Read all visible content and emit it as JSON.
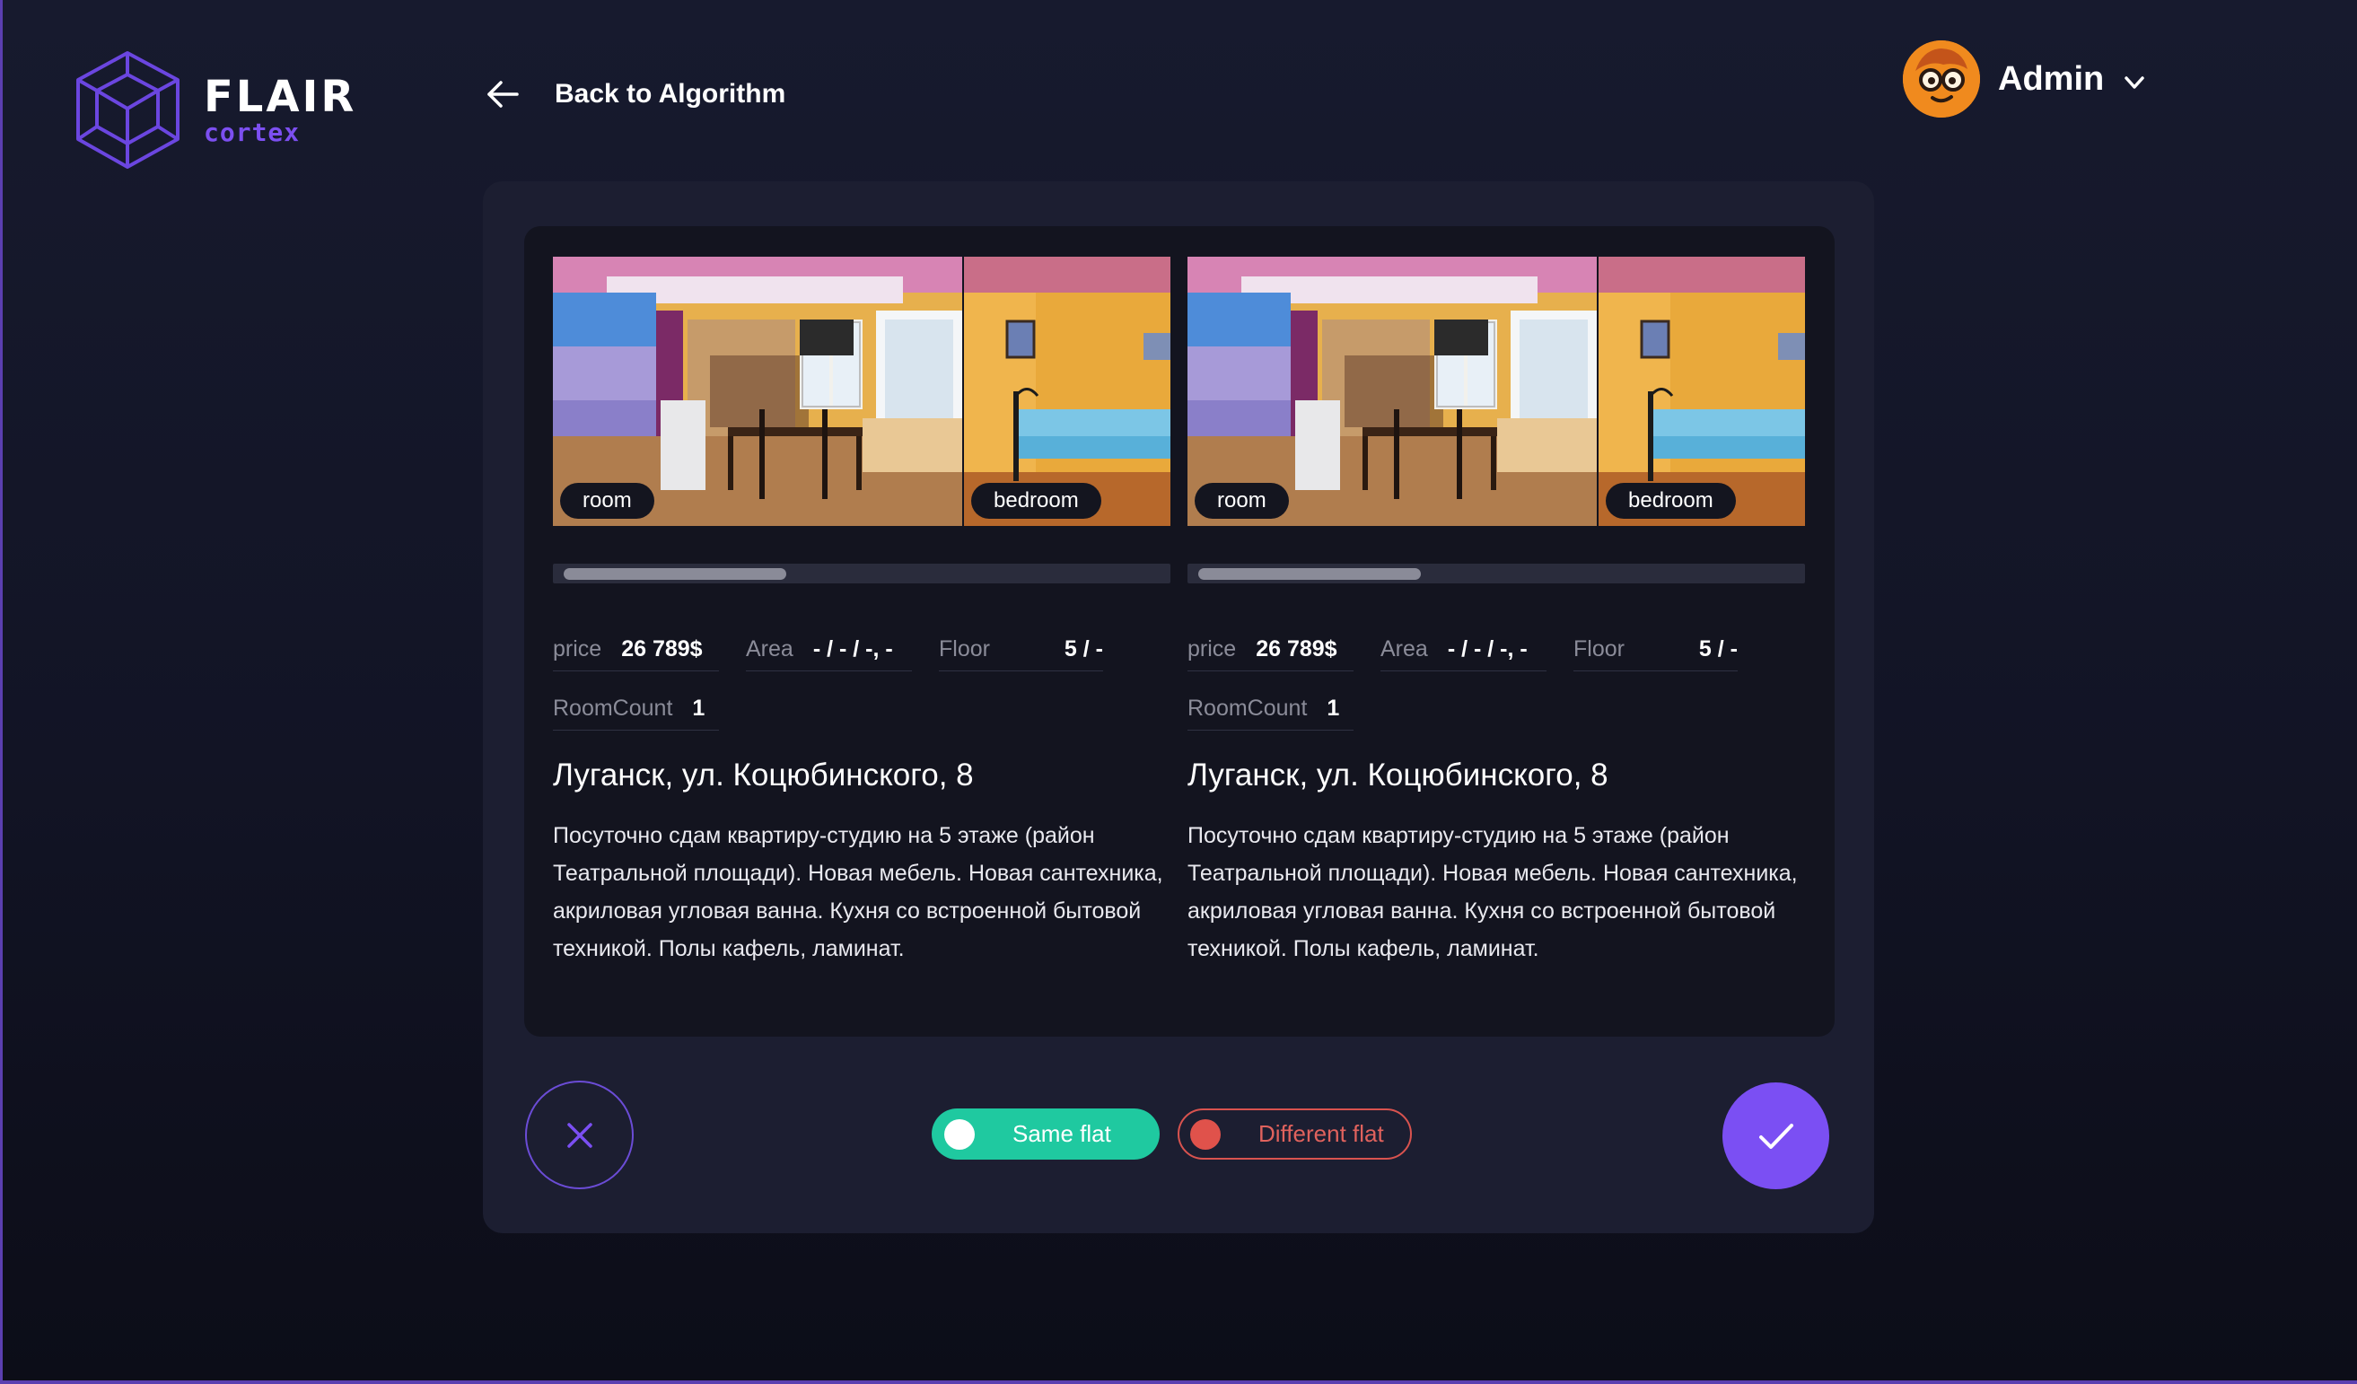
{
  "brand": {
    "name": "FLAIR",
    "sub": "cortex"
  },
  "nav": {
    "back_label": "Back to Algorithm"
  },
  "user": {
    "name": "Admin"
  },
  "listings": [
    {
      "photos": [
        {
          "label": "room"
        },
        {
          "label": "bedroom"
        }
      ],
      "props": {
        "price_label": "price",
        "price_value": "26 789$",
        "area_label": "Area",
        "area_value": "- / - / -, -",
        "floor_label": "Floor",
        "floor_value": "5 / -",
        "rooms_label": "RoomCount",
        "rooms_value": "1"
      },
      "address": "Луганск, ул. Коцюбинского, 8",
      "description": "Посуточно сдам квартиру-студию на 5 этаже (район Театральной площади). Новая мебель. Новая сантехника, акриловая угловая ванна. Кухня со встроенной бытовой техникой. Полы кафель, ламинат."
    },
    {
      "photos": [
        {
          "label": "room"
        },
        {
          "label": "bedroom"
        }
      ],
      "props": {
        "price_label": "price",
        "price_value": "26 789$",
        "area_label": "Area",
        "area_value": "- / - / -, -",
        "floor_label": "Floor",
        "floor_value": "5 / -",
        "rooms_label": "RoomCount",
        "rooms_value": "1"
      },
      "address": "Луганск, ул. Коцюбинского, 8",
      "description": "Посуточно сдам квартиру-студию на 5 этаже (район Театральной площади). Новая мебель. Новая сантехника, акриловая угловая ванна. Кухня со встроенной бытовой техникой. Полы кафель, ламинат."
    }
  ],
  "decision": {
    "same_label": "Same flat",
    "different_label": "Different flat"
  },
  "icons": {
    "logo": "cube-logo-icon",
    "back": "arrow-left-icon",
    "avatar": "nerd-face-avatar",
    "dropdown": "chevron-down-icon",
    "reject": "close-icon",
    "accept": "check-icon"
  },
  "colors": {
    "accent": "#7b4ff3",
    "same": "#1fc9a0",
    "different": "#d9534f"
  }
}
